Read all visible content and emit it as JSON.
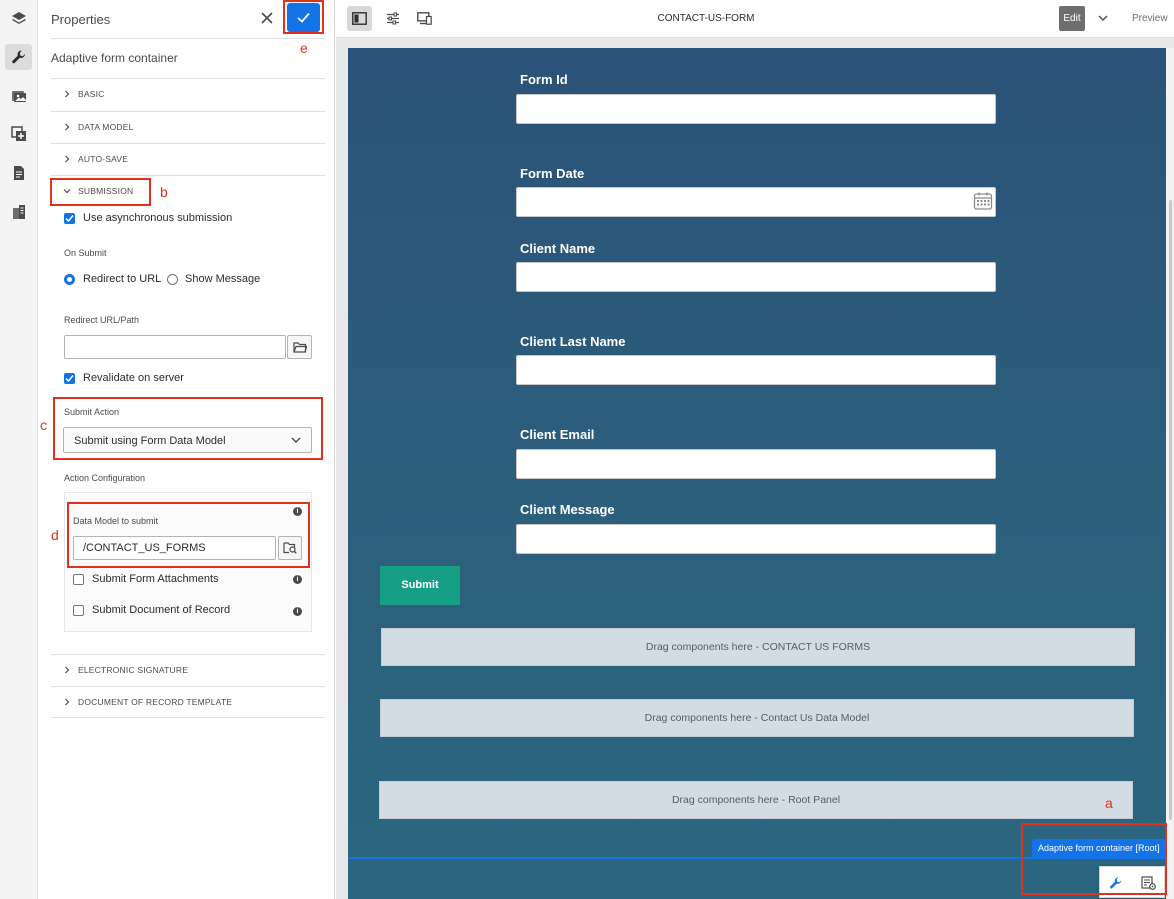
{
  "rail": {
    "items": [
      "layers-icon",
      "wrench-icon",
      "assets-icon",
      "add-component-icon",
      "document-icon",
      "content-tree-icon"
    ]
  },
  "panel": {
    "title": "Properties",
    "component_title": "Adaptive form container",
    "sections": {
      "basic": "BASIC",
      "data_model": "DATA MODEL",
      "auto_save": "AUTO-SAVE",
      "submission": "SUBMISSION",
      "electronic_signature": "ELECTRONIC SIGNATURE",
      "dor_template": "DOCUMENT OF RECORD TEMPLATE"
    },
    "submission": {
      "async_label": "Use asynchronous submission",
      "on_submit_label": "On Submit",
      "redirect_label": "Redirect to URL",
      "show_message_label": "Show Message",
      "redirect_url_label": "Redirect URL/Path",
      "redirect_url_value": "",
      "revalidate_label": "Revalidate on server",
      "submit_action_label": "Submit Action",
      "submit_action_value": "Submit using Form Data Model",
      "action_config_label": "Action Configuration",
      "data_model_label": "Data Model to submit",
      "data_model_value": "/CONTACT_US_FORMS",
      "attachments_label": "Submit Form Attachments",
      "dor_label": "Submit Document of Record"
    }
  },
  "annotations": {
    "a": "a",
    "b": "b",
    "c": "c",
    "d": "d",
    "e": "e"
  },
  "toolbar": {
    "title": "CONTACT-US-FORM",
    "edit_label": "Edit",
    "preview_label": "Preview"
  },
  "form": {
    "fields": {
      "form_id": "Form Id",
      "form_date": "Form Date",
      "client_name": "Client Name",
      "client_last_name": "Client Last Name",
      "client_email": "Client Email",
      "client_message": "Client Message"
    },
    "submit_label": "Submit",
    "drop_zones": {
      "contact_us_forms": "Drag components here - CONTACT US FORMS",
      "contact_us_data_model": "Drag components here - Contact Us Data Model",
      "root_panel": "Drag components here - Root Panel"
    },
    "selection_badge": "Adaptive form container [Root]"
  },
  "colors": {
    "accent": "#1473e6",
    "submit": "#15a085",
    "annotation": "#e0301e"
  }
}
